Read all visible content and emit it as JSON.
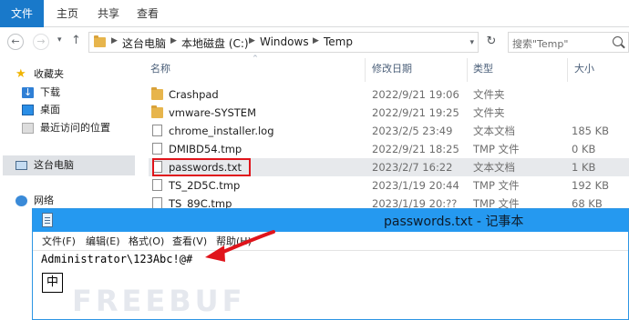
{
  "ribbon": {
    "tabs": [
      {
        "label": "文件"
      },
      {
        "label": "主页"
      },
      {
        "label": "共享"
      },
      {
        "label": "查看"
      }
    ]
  },
  "address": {
    "breadcrumbs": [
      "这台电脑",
      "本地磁盘 (C:)",
      "Windows",
      "Temp"
    ],
    "search_placeholder": "搜索\"Temp\""
  },
  "nav_pane": {
    "favorites_label": "收藏夹",
    "favorites": [
      {
        "label": "下载",
        "icon": "download-icon"
      },
      {
        "label": "桌面",
        "icon": "desktop-icon"
      },
      {
        "label": "最近访问的位置",
        "icon": "recent-places-icon"
      }
    ],
    "this_pc_label": "这台电脑",
    "network_label": "网络"
  },
  "file_list": {
    "columns": [
      "名称",
      "修改日期",
      "类型",
      "大小"
    ],
    "rows": [
      {
        "name": "Crashpad",
        "date": "2022/9/21 19:06",
        "type": "文件夹",
        "size": "",
        "icon": "folder-icon"
      },
      {
        "name": "vmware-SYSTEM",
        "date": "2022/9/21 19:25",
        "type": "文件夹",
        "size": "",
        "icon": "folder-icon"
      },
      {
        "name": "chrome_installer.log",
        "date": "2023/2/5 23:49",
        "type": "文本文档",
        "size": "185 KB",
        "icon": "text-file-icon"
      },
      {
        "name": "DMIBD54.tmp",
        "date": "2022/9/21 18:25",
        "type": "TMP 文件",
        "size": "0 KB",
        "icon": "file-icon"
      },
      {
        "name": "passwords.txt",
        "date": "2023/2/7 16:22",
        "type": "文本文档",
        "size": "1 KB",
        "icon": "text-file-icon"
      },
      {
        "name": "TS_2D5C.tmp",
        "date": "2023/1/19 20:44",
        "type": "TMP 文件",
        "size": "192 KB",
        "icon": "file-icon"
      },
      {
        "name": "TS_89C.tmp",
        "date": "2023/1/19 20:??",
        "type": "TMP 文件",
        "size": "68 KB",
        "icon": "file-icon"
      }
    ]
  },
  "notepad": {
    "title": "passwords.txt - 记事本",
    "menu": [
      "文件(F)",
      "编辑(E)",
      "格式(O)",
      "查看(V)",
      "帮助(H)"
    ],
    "content": "Administrator\\123Abc!@#",
    "ime_indicator": "中"
  },
  "watermark": "FREEBUF",
  "colors": {
    "accent": "#1979ca",
    "notepad_title_bar": "#2599f0",
    "annotation_red": "#e0141b"
  }
}
